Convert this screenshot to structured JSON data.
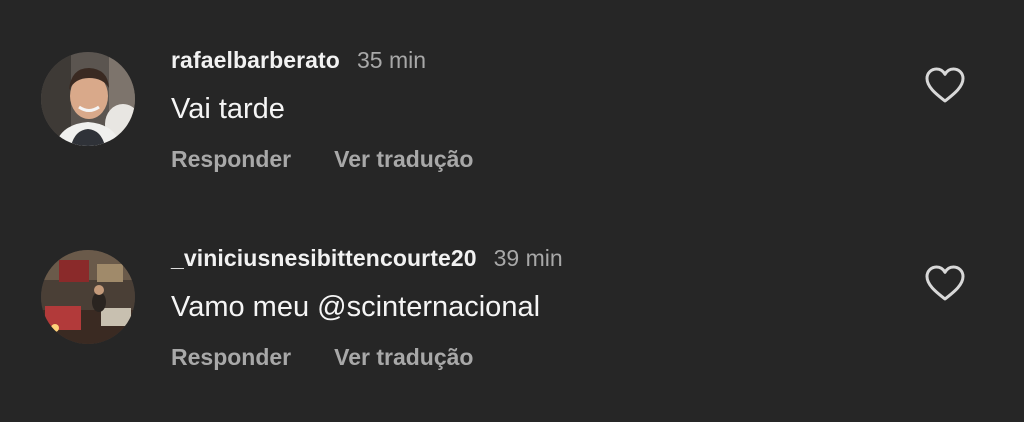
{
  "comments": [
    {
      "username": "rafaelbarberato",
      "time": "35 min",
      "text": "Vai tarde",
      "reply_label": "Responder",
      "translate_label": "Ver tradução",
      "like_icon": "heart-outline-icon"
    },
    {
      "username": "_viniciusnesibittencourte20",
      "time": "39 min",
      "text": "Vamo meu @scinternacional",
      "reply_label": "Responder",
      "translate_label": "Ver tradução",
      "like_icon": "heart-outline-icon"
    }
  ],
  "colors": {
    "background": "#262626",
    "username": "#f2f2f2",
    "secondary_text": "#a8a8a8",
    "comment_text": "#f5f5f5",
    "icon_stroke": "#d8d8d8"
  }
}
